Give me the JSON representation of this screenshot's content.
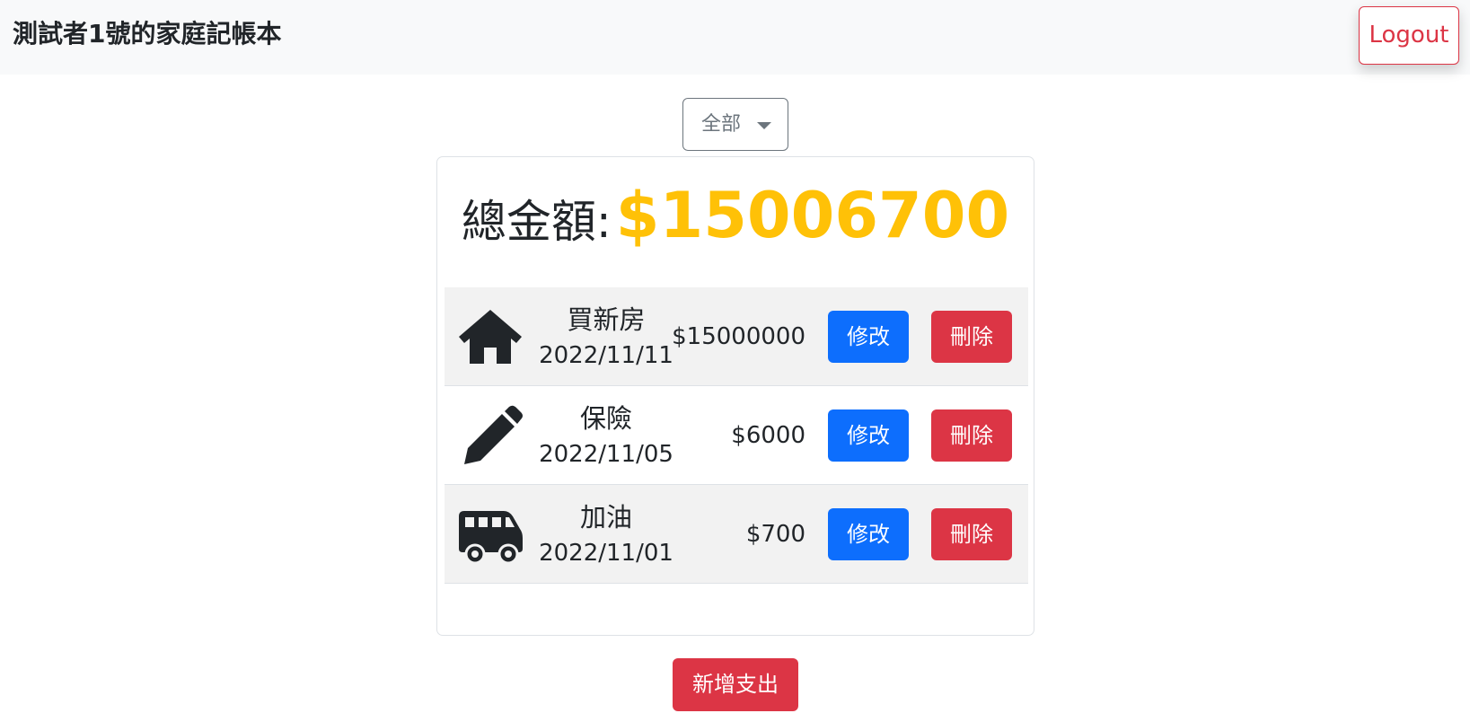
{
  "navbar": {
    "title": "測試者1號的家庭記帳本",
    "logout_label": "Logout"
  },
  "filter": {
    "selected": "全部"
  },
  "summary": {
    "label": "總金額:",
    "amount": "$15006700",
    "amount_color": "#ffc107"
  },
  "expenses": [
    {
      "icon": "house-icon",
      "name": "買新房",
      "date": "2022/11/11",
      "amount": "$15000000",
      "edit_label": "修改",
      "delete_label": "刪除"
    },
    {
      "icon": "pencil-icon",
      "name": "保險",
      "date": "2022/11/05",
      "amount": "$6000",
      "edit_label": "修改",
      "delete_label": "刪除"
    },
    {
      "icon": "van-icon",
      "name": "加油",
      "date": "2022/11/01",
      "amount": "$700",
      "edit_label": "修改",
      "delete_label": "刪除"
    }
  ],
  "add_button_label": "新增支出",
  "colors": {
    "primary": "#0d6efd",
    "danger": "#dc3545",
    "secondary": "#6c757d",
    "navbar_bg": "#f8f9fa"
  }
}
